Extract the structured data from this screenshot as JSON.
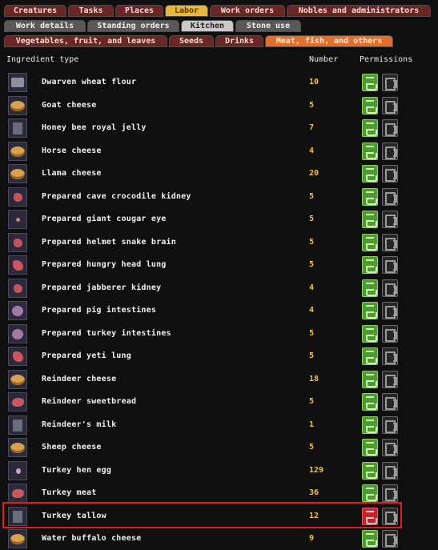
{
  "tabs_row1": [
    "Creatures",
    "Tasks",
    "Places",
    "Labor",
    "Work orders",
    "Nobles and administrators"
  ],
  "tabs_row2": [
    "Work details",
    "Standing orders",
    "Kitchen",
    "Stone use"
  ],
  "tabs_row3": [
    "Vegetables, fruit, and leaves",
    "Seeds",
    "Drinks",
    "Meat, fish, and others"
  ],
  "headers": {
    "ingredient": "Ingredient type",
    "number": "Number",
    "permissions": "Permissions"
  },
  "colors": {
    "cook_allowed": "#4a9c2c",
    "cook_forbidden": "#c7222a",
    "number": "#f6c52a",
    "highlight": "#e01c1c"
  },
  "items": [
    {
      "name": "Dwarven wheat flour",
      "number": "10",
      "icon": "flour-bag-icon",
      "cook": "allowed"
    },
    {
      "name": "Goat cheese",
      "number": "5",
      "icon": "cheese-wheel-icon",
      "cook": "allowed"
    },
    {
      "name": "Honey bee royal jelly",
      "number": "7",
      "icon": "jelly-icon",
      "cook": "allowed"
    },
    {
      "name": "Horse cheese",
      "number": "4",
      "icon": "cheese-wheel-icon",
      "cook": "allowed"
    },
    {
      "name": "Llama cheese",
      "number": "20",
      "icon": "cheese-wheel-icon",
      "cook": "allowed"
    },
    {
      "name": "Prepared cave crocodile kidney",
      "number": "5",
      "icon": "kidney-icon",
      "cook": "allowed"
    },
    {
      "name": "Prepared giant cougar eye",
      "number": "5",
      "icon": "eye-icon",
      "cook": "allowed"
    },
    {
      "name": "Prepared helmet snake brain",
      "number": "5",
      "icon": "brain-icon",
      "cook": "allowed"
    },
    {
      "name": "Prepared hungry head lung",
      "number": "5",
      "icon": "lung-icon",
      "cook": "allowed"
    },
    {
      "name": "Prepared jabberer kidney",
      "number": "4",
      "icon": "kidney-icon",
      "cook": "allowed"
    },
    {
      "name": "Prepared pig intestines",
      "number": "4",
      "icon": "intestines-icon",
      "cook": "allowed"
    },
    {
      "name": "Prepared turkey intestines",
      "number": "5",
      "icon": "intestines-icon",
      "cook": "allowed"
    },
    {
      "name": "Prepared yeti lung",
      "number": "5",
      "icon": "lung-icon",
      "cook": "allowed"
    },
    {
      "name": "Reindeer cheese",
      "number": "18",
      "icon": "cheese-wheel-icon",
      "cook": "allowed"
    },
    {
      "name": "Reindeer sweetbread",
      "number": "5",
      "icon": "sweetbread-icon",
      "cook": "allowed"
    },
    {
      "name": "Reindeer's milk",
      "number": "1",
      "icon": "milk-icon",
      "cook": "allowed"
    },
    {
      "name": "Sheep cheese",
      "number": "5",
      "icon": "cheese-wheel-icon",
      "cook": "allowed"
    },
    {
      "name": "Turkey hen egg",
      "number": "129",
      "icon": "egg-icon",
      "cook": "allowed"
    },
    {
      "name": "Turkey meat",
      "number": "36",
      "icon": "meat-icon",
      "cook": "allowed"
    },
    {
      "name": "Turkey tallow",
      "number": "12",
      "icon": "tallow-icon",
      "cook": "forbidden"
    },
    {
      "name": "Water buffalo cheese",
      "number": "9",
      "icon": "cheese-wheel-icon",
      "cook": "allowed"
    }
  ]
}
